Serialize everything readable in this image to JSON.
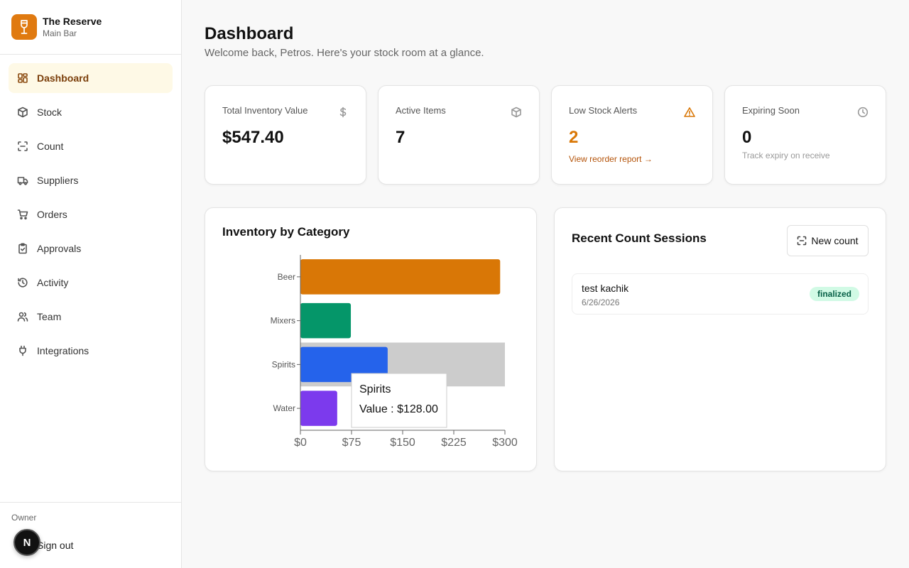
{
  "brand": {
    "name": "The Reserve",
    "subtitle": "Main Bar"
  },
  "nav": [
    {
      "label": "Dashboard",
      "icon": "dashboard-icon",
      "active": true
    },
    {
      "label": "Stock",
      "icon": "box-icon"
    },
    {
      "label": "Count",
      "icon": "scan-icon"
    },
    {
      "label": "Suppliers",
      "icon": "truck-icon"
    },
    {
      "label": "Orders",
      "icon": "cart-icon"
    },
    {
      "label": "Approvals",
      "icon": "clipboard-check-icon"
    },
    {
      "label": "Activity",
      "icon": "history-icon"
    },
    {
      "label": "Team",
      "icon": "users-icon"
    },
    {
      "label": "Integrations",
      "icon": "plug-icon"
    }
  ],
  "footer": {
    "role": "Owner",
    "signout": "Sign out",
    "avatar": "N"
  },
  "header": {
    "title": "Dashboard",
    "subtitle": "Welcome back, Petros. Here's your stock room at a glance."
  },
  "stats": [
    {
      "label": "Total Inventory Value",
      "value": "$547.40",
      "icon": "dollar-icon"
    },
    {
      "label": "Active Items",
      "value": "7",
      "icon": "box-icon"
    },
    {
      "label": "Low Stock Alerts",
      "value": "2",
      "icon": "alert-triangle-icon",
      "link": "View reorder report →",
      "accent": "#d97706"
    },
    {
      "label": "Expiring Soon",
      "value": "0",
      "icon": "clock-icon",
      "note": "Track expiry on receive"
    }
  ],
  "category_card": {
    "title": "Inventory by Category"
  },
  "chart_data": {
    "type": "bar",
    "orientation": "horizontal",
    "categories": [
      "Beer",
      "Mixers",
      "Spirits",
      "Water"
    ],
    "values": [
      293,
      74,
      128,
      54
    ],
    "colors": [
      "#d97706",
      "#059669",
      "#2563eb",
      "#7c3aed"
    ],
    "xlim": [
      0,
      300
    ],
    "xticks": [
      "$0",
      "$75",
      "$150",
      "$225",
      "$300"
    ],
    "xtick_values": [
      0,
      75,
      150,
      225,
      300
    ],
    "hovered_category": "Spirits",
    "tooltip": {
      "title": "Spirits",
      "line": "Value : $128.00"
    }
  },
  "sessions_card": {
    "title": "Recent Count Sessions",
    "new_count_label": "New count",
    "sessions": [
      {
        "name": "test kachik",
        "date": "6/26/2026",
        "status": "finalized"
      }
    ]
  }
}
